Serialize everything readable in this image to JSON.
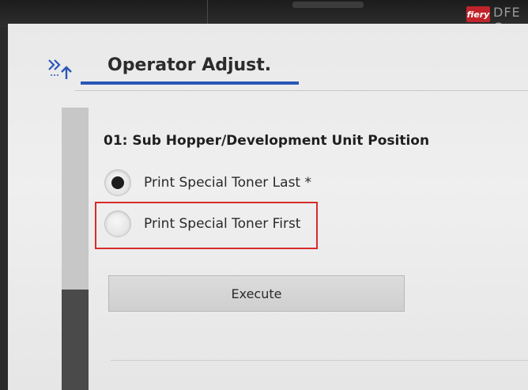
{
  "header": {
    "title": "Operator Adjust.",
    "logo_text": "fiery",
    "brand_tail": "DFE C"
  },
  "section": {
    "heading": "01:  Sub Hopper/Development Unit Position"
  },
  "options": [
    {
      "label": "Print Special Toner Last *",
      "selected": true
    },
    {
      "label": "Print Special Toner First",
      "selected": false
    }
  ],
  "execute_label": "Execute",
  "colors": {
    "accent_blue": "#2a56b8",
    "highlight_red": "#d92b2b",
    "logo_red": "#c0242a"
  },
  "icons": {
    "back": "back-arrow-icon"
  }
}
